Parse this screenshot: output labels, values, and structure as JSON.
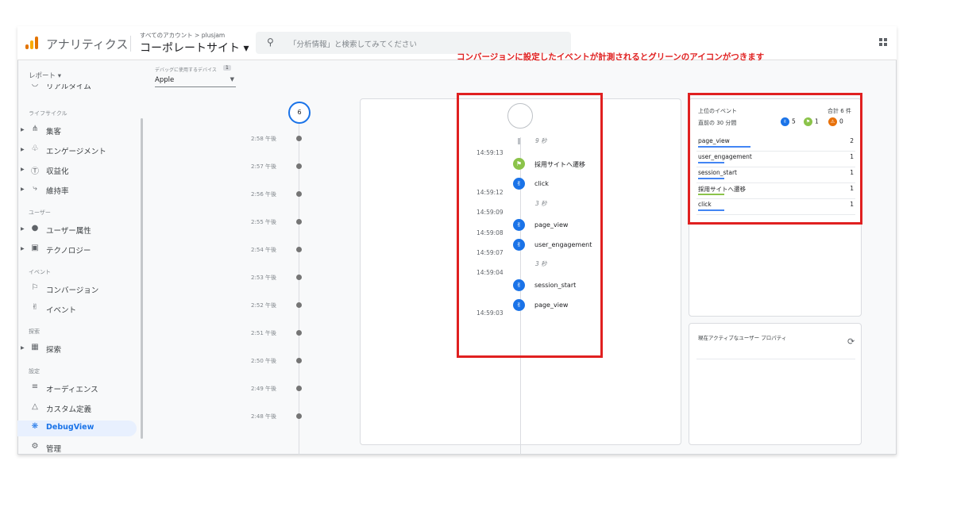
{
  "header": {
    "app_title": "アナリティクス",
    "breadcrumb": "すべてのアカウント > plusjam",
    "property_name": "コーポレートサイト ▾",
    "search_placeholder": "「分析情報」と検索してみてください"
  },
  "sidebar": {
    "header": "レポート ▾",
    "partial_item": "リアルタイム",
    "sections": [
      {
        "title": "ライフサイクル",
        "items": [
          "集客",
          "エンゲージメント",
          "収益化",
          "維持率"
        ]
      },
      {
        "title": "ユーザー",
        "items": [
          "ユーザー属性",
          "テクノロジー"
        ]
      },
      {
        "title": "イベント",
        "items": [
          "コンバージョン",
          "イベント"
        ]
      },
      {
        "title": "探索",
        "items": [
          "探索"
        ]
      },
      {
        "title": "設定",
        "items": [
          "オーディエンス",
          "カスタム定義",
          "DebugView",
          "管理"
        ]
      }
    ]
  },
  "device": {
    "label": "デバッグに使用するデバイス",
    "count": "1",
    "value": "Apple"
  },
  "minutes": {
    "top_count": "6",
    "times": [
      "2:58 午後",
      "2:57 午後",
      "2:56 午後",
      "2:55 午後",
      "2:54 午後",
      "2:53 午後",
      "2:52 午後",
      "2:51 午後",
      "2:50 午後",
      "2:49 午後",
      "2:48 午後"
    ]
  },
  "stream": {
    "gaps": [
      "9 秒",
      "3 秒",
      "3 秒"
    ],
    "timestamps": [
      "14:59:13",
      "14:59:12",
      "14:59:09",
      "14:59:08",
      "14:59:07",
      "14:59:04",
      "14:59:03"
    ],
    "events": [
      {
        "name": "採用サイトへ遷移",
        "kind": "conversion",
        "icon": "flag-icon"
      },
      {
        "name": "click",
        "kind": "event",
        "icon": "touch-icon"
      },
      {
        "name": "page_view",
        "kind": "event",
        "icon": "touch-icon"
      },
      {
        "name": "user_engagement",
        "kind": "event",
        "icon": "touch-icon"
      },
      {
        "name": "session_start",
        "kind": "event",
        "icon": "touch-icon"
      },
      {
        "name": "page_view",
        "kind": "event",
        "icon": "touch-icon"
      }
    ]
  },
  "annotation": "コンバージョンに設定したイベントが計測されるとグリーンのアイコンがつきます",
  "top_events": {
    "title": "上位のイベント",
    "total": "合計 6 件",
    "subtitle": "直前の 30 分間",
    "counts": {
      "event": "5",
      "conversion": "1",
      "error": "0"
    },
    "rows": [
      {
        "name": "page_view",
        "value": "2",
        "bar_fraction": 1.0,
        "color": "#4285f4"
      },
      {
        "name": "user_engagement",
        "value": "1",
        "bar_fraction": 0.5,
        "color": "#4285f4"
      },
      {
        "name": "session_start",
        "value": "1",
        "bar_fraction": 0.5,
        "color": "#4285f4"
      },
      {
        "name": "採用サイトへ遷移",
        "value": "1",
        "bar_fraction": 0.5,
        "color": "#8bc34a"
      },
      {
        "name": "click",
        "value": "1",
        "bar_fraction": 0.5,
        "color": "#4285f4"
      }
    ]
  },
  "user_props": {
    "title": "現在アクティブなユーザー プロパティ"
  },
  "colors": {
    "event_blue": "#1a73e8",
    "conversion_green": "#8bc34a",
    "error_orange": "#e8710a",
    "annotation_red": "#e02020"
  }
}
